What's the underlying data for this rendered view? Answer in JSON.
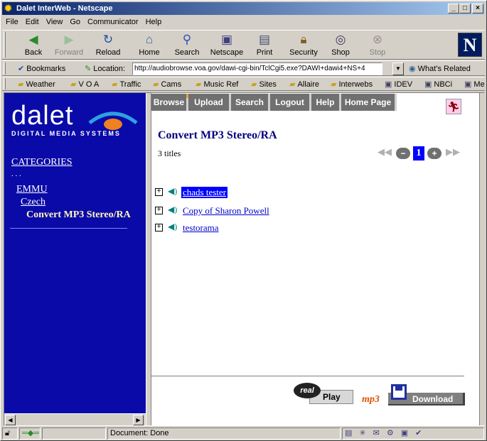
{
  "window": {
    "title": "Dalet InterWeb - Netscape"
  },
  "menu": [
    "File",
    "Edit",
    "View",
    "Go",
    "Communicator",
    "Help"
  ],
  "nav": {
    "back": "Back",
    "forward": "Forward",
    "reload": "Reload",
    "home": "Home",
    "search": "Search",
    "netscape": "Netscape",
    "print": "Print",
    "security": "Security",
    "shop": "Shop",
    "stop": "Stop"
  },
  "location": {
    "bookmarks": "Bookmarks",
    "label": "Location:",
    "url": "http://audiobrowse.voa.gov/dawi-cgi-bin/TclCgi5.exe?DAWI+dawi4+NS+4",
    "related": "What's Related"
  },
  "personal": [
    "Weather",
    "V O A",
    "Traffic",
    "Cams",
    "Music Ref",
    "Sites",
    "Allaire",
    "Interwebs",
    "IDEV",
    "NBCi",
    "Me"
  ],
  "sidebar": {
    "logo_word": "dalet",
    "logo_tag": "DIGITAL MEDIA SYSTEMS",
    "categories_label": "CATEGORIES",
    "dots": ". . .",
    "items": [
      {
        "label": "EMMU"
      },
      {
        "label": "Czech"
      },
      {
        "label": "Convert MP3 Stereo/RA"
      }
    ]
  },
  "tabs": [
    "Browse",
    "Upload",
    "Search",
    "Logout",
    "Help",
    "Home Page"
  ],
  "main": {
    "title": "Convert MP3 Stereo/RA",
    "count": "3 titles",
    "page": "1",
    "rows": [
      {
        "label": "chads tester",
        "selected": true
      },
      {
        "label": "Copy of Sharon Powell",
        "selected": false
      },
      {
        "label": "testorama",
        "selected": false
      }
    ],
    "play_label": "Play",
    "real_label": "real",
    "mp3_label": "mp3",
    "download_label": "Download"
  },
  "status": {
    "text": "Document: Done"
  }
}
